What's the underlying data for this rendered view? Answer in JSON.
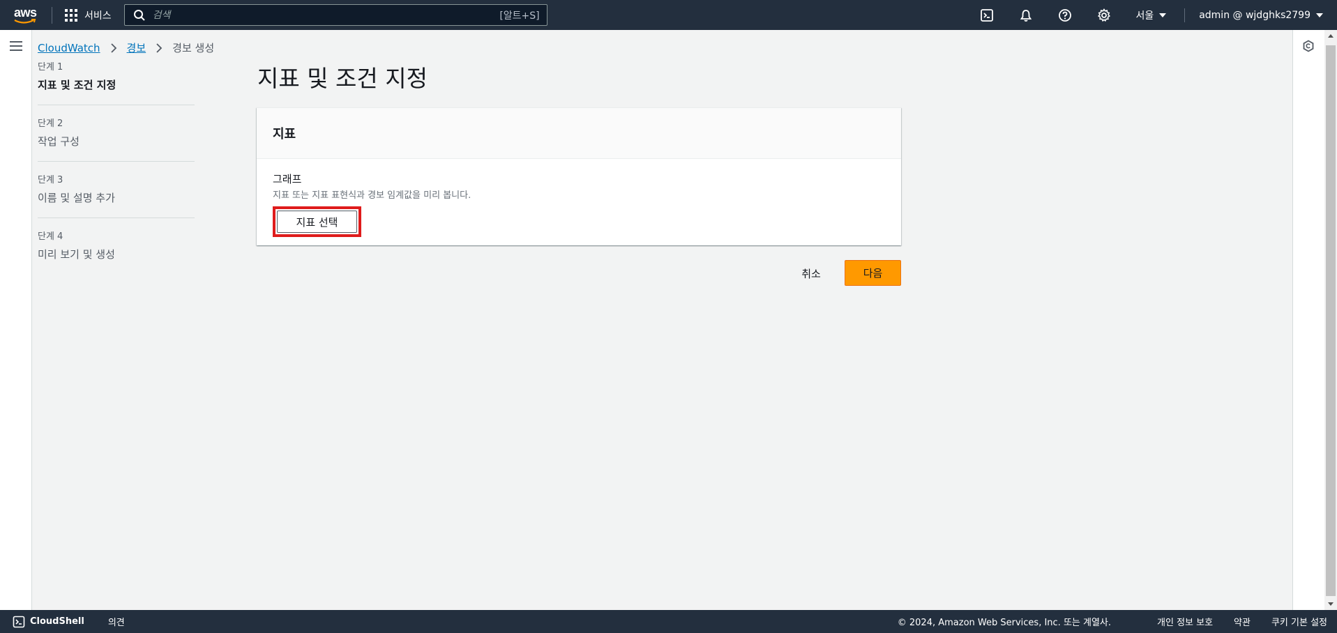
{
  "topnav": {
    "logo_text": "aws",
    "services_label": "서비스",
    "search_placeholder": "검색",
    "search_shortcut": "[알트+S]",
    "region": "서울",
    "account": "admin @ wjdghks2799"
  },
  "breadcrumb": {
    "items": [
      "CloudWatch",
      "경보"
    ],
    "current": "경보 생성"
  },
  "steps": [
    {
      "num": "단계 1",
      "title": "지표 및 조건 지정",
      "active": true
    },
    {
      "num": "단계 2",
      "title": "작업 구성",
      "active": false
    },
    {
      "num": "단계 3",
      "title": "이름 및 설명 추가",
      "active": false
    },
    {
      "num": "단계 4",
      "title": "미리 보기 및 생성",
      "active": false
    }
  ],
  "main": {
    "title": "지표 및 조건 지정",
    "panel_title": "지표",
    "graph_label": "그래프",
    "graph_desc": "지표 또는 지표 표현식과 경보 임계값을 미리 봅니다.",
    "select_metric_label": "지표 선택",
    "cancel_label": "취소",
    "next_label": "다음"
  },
  "footer": {
    "cloudshell_label": "CloudShell",
    "feedback_label": "의견",
    "copyright": "© 2024, Amazon Web Services, Inc. 또는 계열사.",
    "privacy": "개인 정보 보호",
    "terms": "약관",
    "cookies": "쿠키 기본 설정"
  },
  "colors": {
    "nav_bg": "#232f3e",
    "accent_orange": "#ff9900",
    "link_blue": "#0073bb",
    "highlight_red": "#df1c1c"
  }
}
